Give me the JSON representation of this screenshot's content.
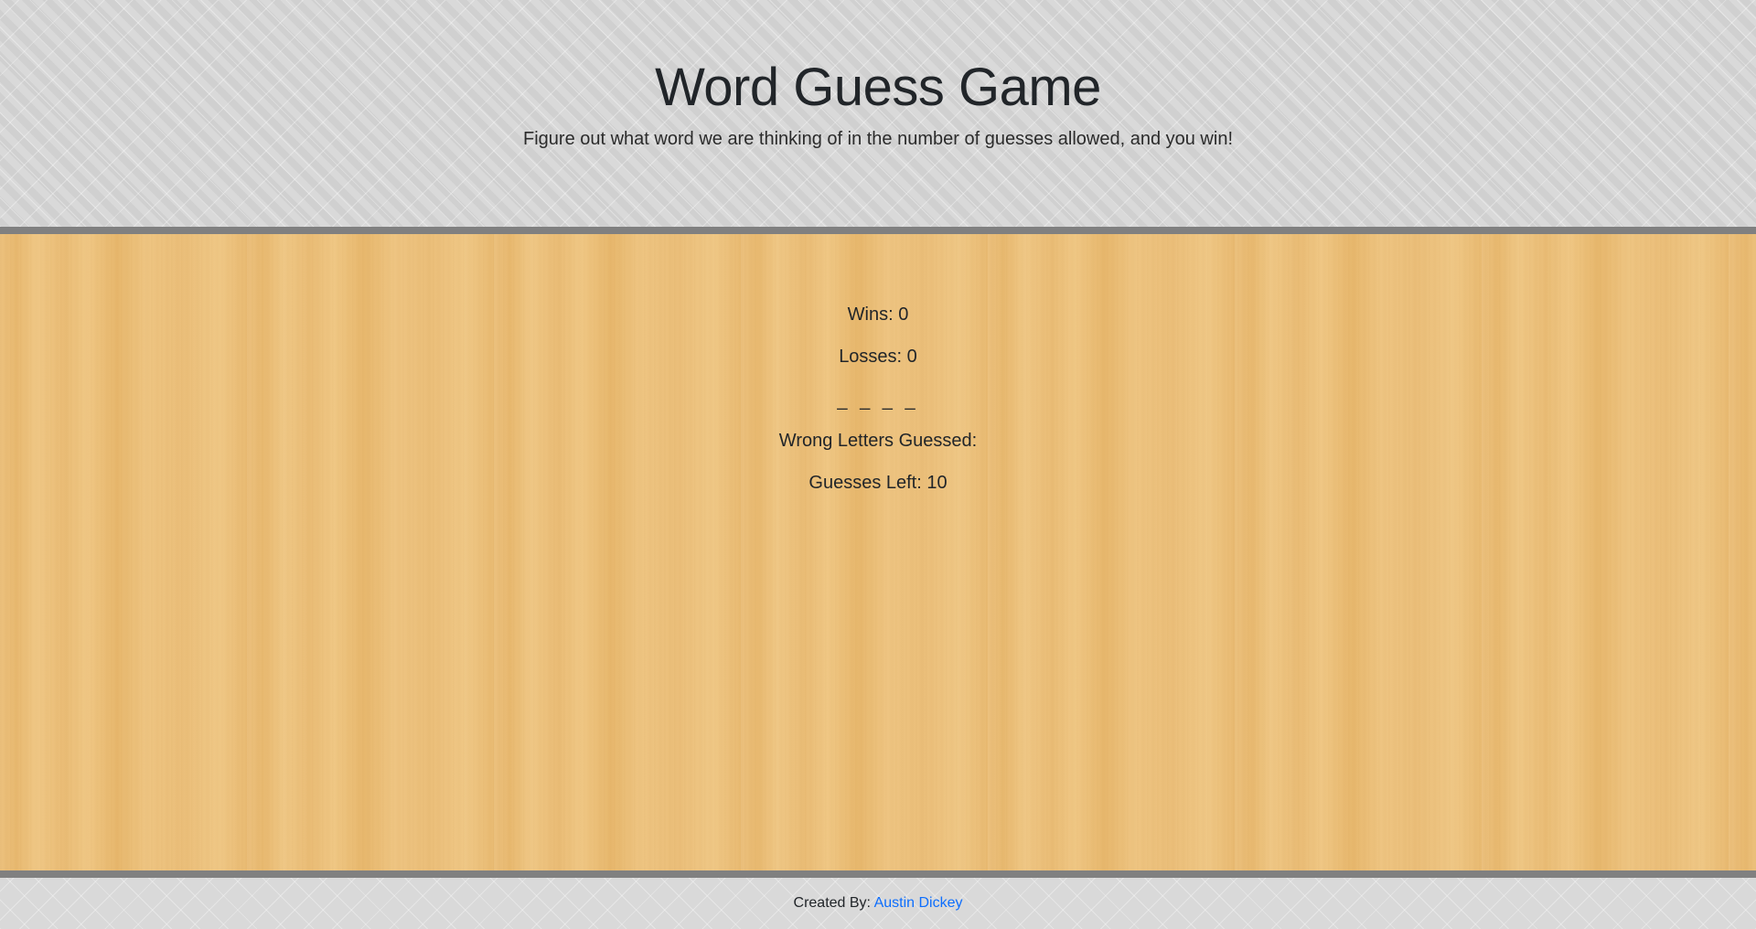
{
  "header": {
    "title": "Word Guess Game",
    "subtitle": "Figure out what word we are thinking of in the number of guesses allowed, and you win!"
  },
  "game": {
    "wins_text": "Wins: 0",
    "losses_text": "Losses: 0",
    "current_word": "_ _ _ _",
    "wrong_letters_text": "Wrong Letters Guessed:",
    "guesses_left_text": "Guesses Left: 10"
  },
  "footer": {
    "created_by_label": "Created By:",
    "author_link": "Austin Dickey",
    "link_color": "#0d6efd"
  },
  "colors": {
    "header_background": "#d9d9d9",
    "divider": "#808080",
    "board_background": "#ecc17e"
  }
}
